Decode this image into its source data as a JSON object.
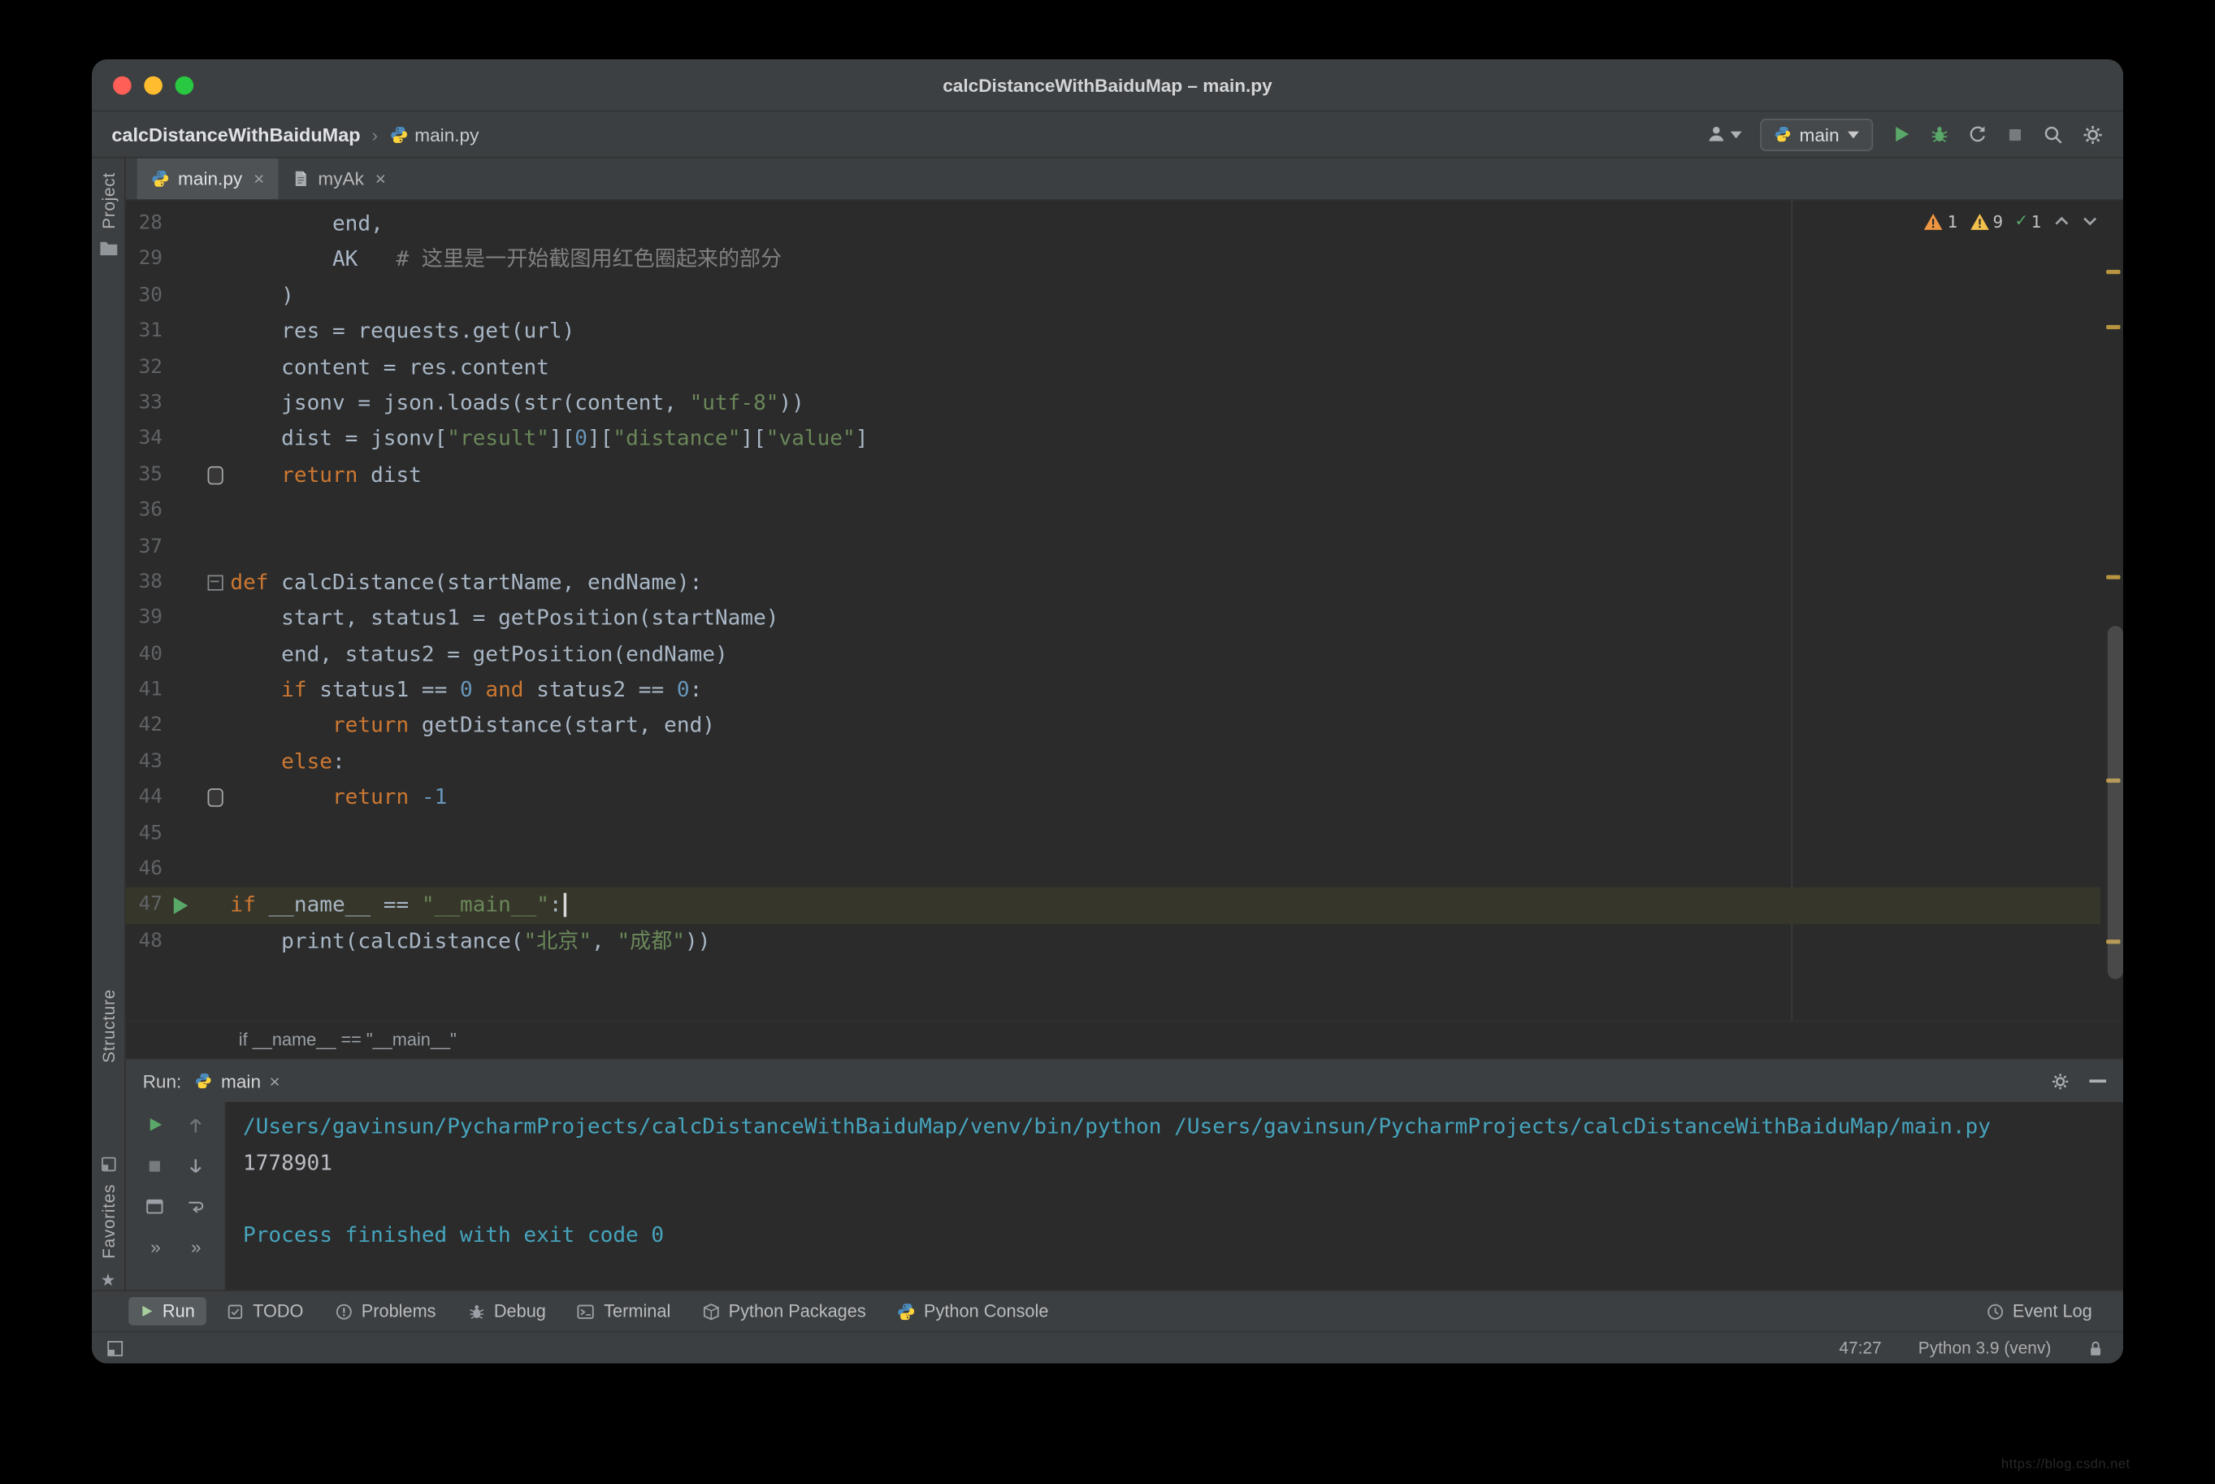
{
  "window_title": "calcDistanceWithBaiduMap – main.py",
  "nav": {
    "project": "calcDistanceWithBaiduMap",
    "separator": "›",
    "file": "main.py",
    "run_config": "main"
  },
  "tabs": [
    {
      "label": "main.py",
      "icon": "python",
      "active": true
    },
    {
      "label": "myAk",
      "icon": "file",
      "active": false
    }
  ],
  "tool_stripes": {
    "project": "Project",
    "structure": "Structure",
    "favorites": "Favorites"
  },
  "inspections": {
    "warnings_strong": "1",
    "warnings_weak": "9",
    "passed": "1"
  },
  "editor": {
    "breadcrumb": "if __name__ == \"__main__\"",
    "right_marks_y": [
      49,
      88,
      265,
      409,
      523
    ],
    "lines": [
      {
        "n": 28,
        "segs": [
          [
            "p",
            "        end,"
          ]
        ]
      },
      {
        "n": 29,
        "segs": [
          [
            "p",
            "        AK   "
          ],
          [
            "c",
            "# 这里是一开始截图用红色圈起来的部分"
          ]
        ]
      },
      {
        "n": 30,
        "segs": [
          [
            "p",
            "    )"
          ]
        ]
      },
      {
        "n": 31,
        "segs": [
          [
            "p",
            "    res = requests.get(url)"
          ]
        ]
      },
      {
        "n": 32,
        "segs": [
          [
            "p",
            "    content = res.content"
          ]
        ]
      },
      {
        "n": 33,
        "segs": [
          [
            "p",
            "    jsonv = json.loads(str(content, "
          ],
          [
            "s",
            "\"utf-8\""
          ],
          [
            "p",
            "))"
          ]
        ]
      },
      {
        "n": 34,
        "segs": [
          [
            "p",
            "    dist = jsonv["
          ],
          [
            "s",
            "\"result\""
          ],
          [
            "p",
            "]["
          ],
          [
            "n2",
            "0"
          ],
          [
            "p",
            "]["
          ],
          [
            "s",
            "\"distance\""
          ],
          [
            "p",
            "]["
          ],
          [
            "s",
            "\"value\""
          ],
          [
            "p",
            "]"
          ]
        ]
      },
      {
        "n": 35,
        "icon": "bookmark",
        "segs": [
          [
            "p",
            "    "
          ],
          [
            "k",
            "return"
          ],
          [
            "p",
            " dist"
          ]
        ]
      },
      {
        "n": 36,
        "segs": []
      },
      {
        "n": 37,
        "segs": []
      },
      {
        "n": 38,
        "icon": "fold",
        "segs": [
          [
            "k",
            "def"
          ],
          [
            "p",
            " calcDistance(startName, endName):"
          ]
        ]
      },
      {
        "n": 39,
        "segs": [
          [
            "p",
            "    start, status1 = getPosition(startName)"
          ]
        ]
      },
      {
        "n": 40,
        "segs": [
          [
            "p",
            "    end, status2 = getPosition(endName)"
          ]
        ]
      },
      {
        "n": 41,
        "segs": [
          [
            "p",
            "    "
          ],
          [
            "k",
            "if"
          ],
          [
            "p",
            " status1 == "
          ],
          [
            "n2",
            "0"
          ],
          [
            "p",
            " "
          ],
          [
            "k",
            "and"
          ],
          [
            "p",
            " status2 == "
          ],
          [
            "n2",
            "0"
          ],
          [
            "p",
            ":"
          ]
        ]
      },
      {
        "n": 42,
        "segs": [
          [
            "p",
            "        "
          ],
          [
            "k",
            "return"
          ],
          [
            "p",
            " getDistance(start, end)"
          ]
        ]
      },
      {
        "n": 43,
        "segs": [
          [
            "p",
            "    "
          ],
          [
            "k",
            "else"
          ],
          [
            "p",
            ":"
          ]
        ]
      },
      {
        "n": 44,
        "icon": "bookmark",
        "segs": [
          [
            "p",
            "        "
          ],
          [
            "k",
            "return"
          ],
          [
            "p",
            " "
          ],
          [
            "n2",
            "-1"
          ]
        ]
      },
      {
        "n": 45,
        "segs": []
      },
      {
        "n": 46,
        "segs": []
      },
      {
        "n": 47,
        "icon": "run",
        "current": true,
        "caret": true,
        "segs": [
          [
            "k",
            "if"
          ],
          [
            "p",
            " __name__ == "
          ],
          [
            "s",
            "\"__main__\""
          ],
          [
            "p",
            ":"
          ]
        ]
      },
      {
        "n": 48,
        "segs": [
          [
            "p",
            "    print(calcDistance("
          ],
          [
            "s",
            "\"北京\""
          ],
          [
            "p",
            ", "
          ],
          [
            "s",
            "\"成都\""
          ],
          [
            "p",
            "))"
          ]
        ]
      }
    ]
  },
  "run_panel": {
    "title": "Run:",
    "tab_label": "main",
    "console_lines": [
      {
        "style": "system",
        "text": "/Users/gavinsun/PycharmProjects/calcDistanceWithBaiduMap/venv/bin/python /Users/gavinsun/PycharmProjects/calcDistanceWithBaiduMap/main.py"
      },
      {
        "style": "stdout",
        "text": "1778901"
      },
      {
        "style": "stdout",
        "text": ""
      },
      {
        "style": "system",
        "text": "Process finished with exit code 0"
      }
    ]
  },
  "status_bar": {
    "buttons": [
      {
        "label": "Run",
        "icon": "run",
        "active": true
      },
      {
        "label": "TODO",
        "icon": "todo",
        "active": false
      },
      {
        "label": "Problems",
        "icon": "problems",
        "active": false
      },
      {
        "label": "Debug",
        "icon": "debug",
        "active": false
      },
      {
        "label": "Terminal",
        "icon": "terminal",
        "active": false
      },
      {
        "label": "Python Packages",
        "icon": "package",
        "active": false
      },
      {
        "label": "Python Console",
        "icon": "python",
        "active": false
      }
    ],
    "event_log": "Event Log",
    "caret_position": "47:27",
    "interpreter": "Python 3.9 (venv)"
  },
  "watermark": "https://blog.csdn.net",
  "colors": {
    "editor_bg": "#2B2B2B",
    "chrome_bg": "#3C3F41",
    "keyword": "#CC7832",
    "string": "#6A8759",
    "number": "#6897BB",
    "comment": "#808080",
    "plain_code": "#A9B7C6",
    "console_system": "#46A4BD",
    "run_green": "#59A869",
    "warning_yellow": "#F2A33C"
  },
  "icons": {
    "close-icon": "×",
    "search-icon": "magnifier shape",
    "gear-icon": "gear shape",
    "python-icon": "blue/yellow python logo",
    "run-icon": "green play triangle",
    "debug-icon": "bug shape",
    "stop-icon": "gray square",
    "rerun-icon": "circular arrow",
    "warning-icon": "yellow triangle",
    "ok-icon": "✓",
    "favorites-star-icon": "★",
    "more-icon": "»"
  }
}
